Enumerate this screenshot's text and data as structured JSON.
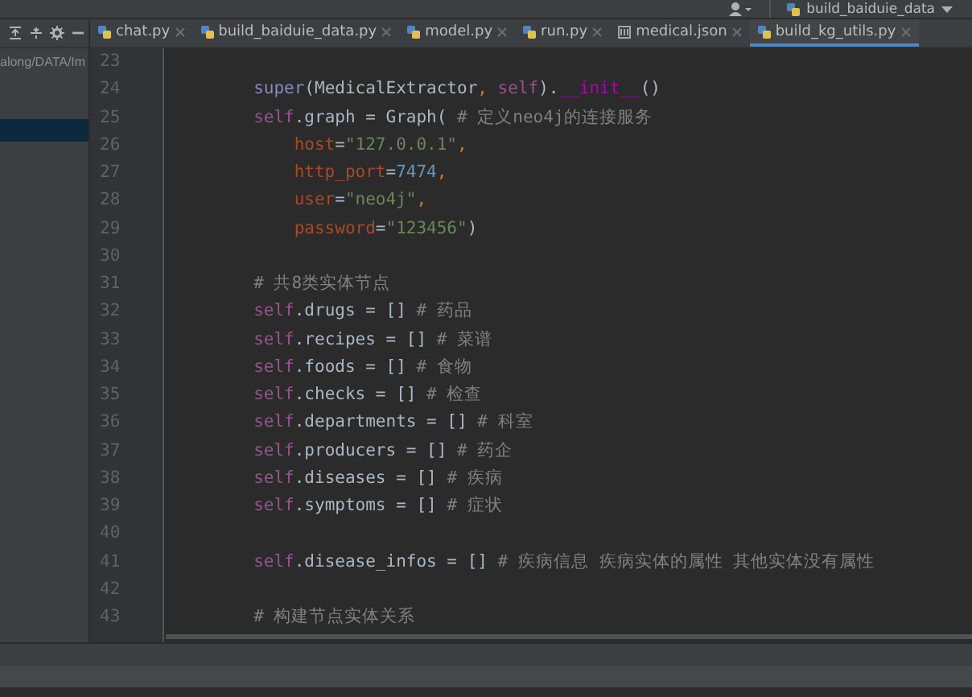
{
  "toolbar": {
    "run_config": "build_baiduie_data"
  },
  "project_panel": {
    "path": "along/DATA/Im",
    "rows": [
      {
        "selected": true
      }
    ]
  },
  "tabs": [
    {
      "label": "chat.py",
      "kind": "python",
      "selected": false
    },
    {
      "label": "build_baiduie_data.py",
      "kind": "python",
      "selected": false
    },
    {
      "label": "model.py",
      "kind": "python",
      "selected": false
    },
    {
      "label": "run.py",
      "kind": "python",
      "selected": false
    },
    {
      "label": "medical.json",
      "kind": "json",
      "selected": false
    },
    {
      "label": "build_kg_utils.py",
      "kind": "python",
      "selected": true
    }
  ],
  "editor": {
    "lines": [
      {
        "number": "23",
        "kind": "blank"
      },
      {
        "number": "24",
        "kind": "statement",
        "tokens": [
          {
            "kind": "builtin",
            "text": "super"
          },
          {
            "kind": "plain",
            "text": "(MedicalExtractor"
          },
          {
            "kind": "punct",
            "text": ", "
          },
          {
            "kind": "self",
            "text": "self"
          },
          {
            "kind": "plain",
            "text": ")."
          },
          {
            "kind": "dunder",
            "text": "__init__"
          },
          {
            "kind": "plain",
            "text": "()"
          }
        ]
      },
      {
        "number": "25",
        "kind": "statement",
        "tokens": [
          {
            "kind": "self",
            "text": "self"
          },
          {
            "kind": "plain",
            "text": ".graph = Graph( "
          },
          {
            "kind": "comment",
            "text": "# 定义neo4j的连接服务"
          }
        ]
      },
      {
        "number": "26",
        "kind": "argument",
        "tokens": [
          {
            "kind": "param",
            "text": "host"
          },
          {
            "kind": "plain",
            "text": "="
          },
          {
            "kind": "string",
            "text": "\"127.0.0.1\""
          },
          {
            "kind": "punct",
            "text": ","
          }
        ]
      },
      {
        "number": "27",
        "kind": "argument",
        "tokens": [
          {
            "kind": "param",
            "text": "http_port"
          },
          {
            "kind": "plain",
            "text": "="
          },
          {
            "kind": "number",
            "text": "7474"
          },
          {
            "kind": "punct",
            "text": ","
          }
        ]
      },
      {
        "number": "28",
        "kind": "argument",
        "tokens": [
          {
            "kind": "param",
            "text": "user"
          },
          {
            "kind": "plain",
            "text": "="
          },
          {
            "kind": "string",
            "text": "\"neo4j\""
          },
          {
            "kind": "punct",
            "text": ","
          }
        ]
      },
      {
        "number": "29",
        "kind": "argument",
        "tokens": [
          {
            "kind": "param",
            "text": "password"
          },
          {
            "kind": "plain",
            "text": "="
          },
          {
            "kind": "string",
            "text": "\"123456\""
          },
          {
            "kind": "plain",
            "text": ")"
          }
        ]
      },
      {
        "number": "30",
        "kind": "blank"
      },
      {
        "number": "31",
        "kind": "statement",
        "tokens": [
          {
            "kind": "comment",
            "text": "# 共8类实体节点"
          }
        ]
      },
      {
        "number": "32",
        "kind": "statement",
        "tokens": [
          {
            "kind": "self",
            "text": "self"
          },
          {
            "kind": "plain",
            "text": ".drugs = [] "
          },
          {
            "kind": "comment",
            "text": "# 药品"
          }
        ]
      },
      {
        "number": "33",
        "kind": "statement",
        "tokens": [
          {
            "kind": "self",
            "text": "self"
          },
          {
            "kind": "plain",
            "text": ".recipes = [] "
          },
          {
            "kind": "comment",
            "text": "# 菜谱"
          }
        ]
      },
      {
        "number": "34",
        "kind": "statement",
        "tokens": [
          {
            "kind": "self",
            "text": "self"
          },
          {
            "kind": "plain",
            "text": ".foods = [] "
          },
          {
            "kind": "comment",
            "text": "# 食物"
          }
        ]
      },
      {
        "number": "35",
        "kind": "statement",
        "tokens": [
          {
            "kind": "self",
            "text": "self"
          },
          {
            "kind": "plain",
            "text": ".checks = [] "
          },
          {
            "kind": "comment",
            "text": "# 检查"
          }
        ]
      },
      {
        "number": "36",
        "kind": "statement",
        "tokens": [
          {
            "kind": "self",
            "text": "self"
          },
          {
            "kind": "plain",
            "text": ".departments = [] "
          },
          {
            "kind": "comment",
            "text": "# 科室"
          }
        ]
      },
      {
        "number": "37",
        "kind": "statement",
        "tokens": [
          {
            "kind": "self",
            "text": "self"
          },
          {
            "kind": "plain",
            "text": ".producers = [] "
          },
          {
            "kind": "comment",
            "text": "# 药企"
          }
        ]
      },
      {
        "number": "38",
        "kind": "statement",
        "tokens": [
          {
            "kind": "self",
            "text": "self"
          },
          {
            "kind": "plain",
            "text": ".diseases = [] "
          },
          {
            "kind": "comment",
            "text": "# 疾病"
          }
        ]
      },
      {
        "number": "39",
        "kind": "statement",
        "tokens": [
          {
            "kind": "self",
            "text": "self"
          },
          {
            "kind": "plain",
            "text": ".symptoms = [] "
          },
          {
            "kind": "comment",
            "text": "# 症状"
          }
        ]
      },
      {
        "number": "40",
        "kind": "blank"
      },
      {
        "number": "41",
        "kind": "statement",
        "tokens": [
          {
            "kind": "self",
            "text": "self"
          },
          {
            "kind": "plain",
            "text": ".disease_infos = [] "
          },
          {
            "kind": "comment",
            "text": "# 疾病信息 疾病实体的属性 其他实体没有属性"
          }
        ]
      },
      {
        "number": "42",
        "kind": "blank"
      },
      {
        "number": "43",
        "kind": "statement",
        "tokens": [
          {
            "kind": "comment",
            "text": "# 构建节点实体关系"
          }
        ]
      }
    ]
  }
}
